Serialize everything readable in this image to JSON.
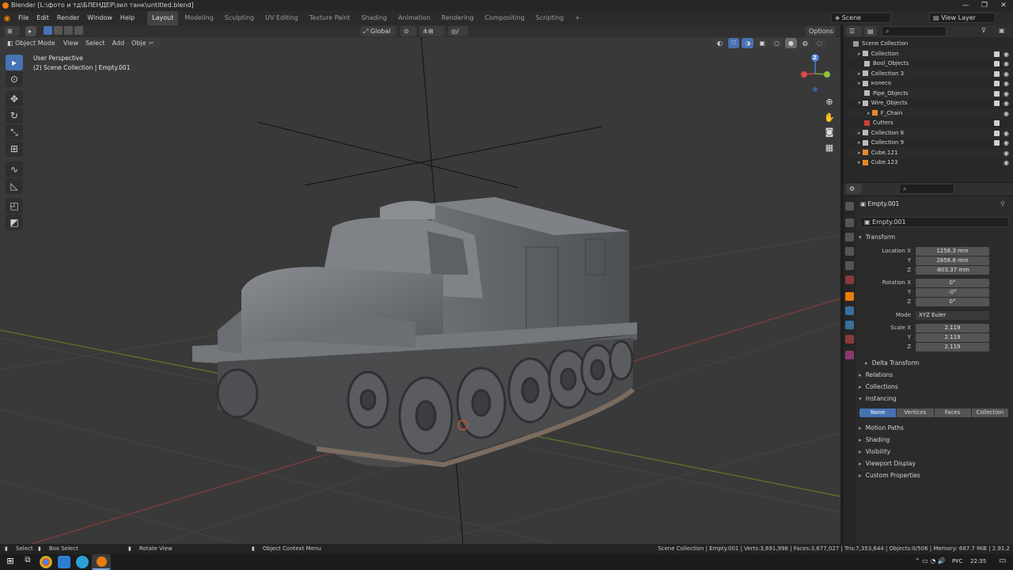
{
  "window": {
    "title": "Blender [L:\\фото и тд\\БЛЕНДЕР\\зил танк\\untitled.blend]",
    "controls": [
      "—",
      "❐",
      "✕"
    ]
  },
  "menubar": {
    "menus": [
      "File",
      "Edit",
      "Render",
      "Window",
      "Help"
    ],
    "workspaces": [
      "Layout",
      "Modeling",
      "Sculpting",
      "UV Editing",
      "Texture Paint",
      "Shading",
      "Animation",
      "Rendering",
      "Compositing",
      "Scripting"
    ],
    "active_workspace": "Layout",
    "add_tab": "+",
    "scene": "Scene",
    "view_layer": "View Layer"
  },
  "viewport_header": {
    "mode": "Object Mode",
    "menus": [
      "View",
      "Select",
      "Add",
      "Object"
    ],
    "orientation": "Global",
    "options": "Options"
  },
  "viewport": {
    "perspective_label": "User Perspective",
    "context_label": "(2) Scene Collection | Empty.001",
    "gizmo_axis_z": "Z"
  },
  "outliner": {
    "root": "Scene Collection",
    "search_placeholder": "",
    "items": [
      {
        "name": "Collection",
        "checked": true,
        "visible": true
      },
      {
        "name": "Bool_Objects",
        "checked": true,
        "visible": true
      },
      {
        "name": "Collection 3",
        "checked": true,
        "visible": true
      },
      {
        "name": "колесо",
        "checked": true,
        "visible": true
      },
      {
        "name": "Pipe_Objects",
        "checked": true,
        "visible": true
      },
      {
        "name": "Wire_Objects",
        "checked": true,
        "visible": true
      },
      {
        "name": "F_Chain",
        "checked": false,
        "visible": true
      },
      {
        "name": "Cutters",
        "checked": true,
        "visible": false
      },
      {
        "name": "Collection 8",
        "checked": true,
        "visible": true
      },
      {
        "name": "Collection 9",
        "checked": true,
        "visible": true
      },
      {
        "name": "Cube.121",
        "checked": false,
        "visible": true
      },
      {
        "name": "Cube.123",
        "checked": false,
        "visible": true
      }
    ]
  },
  "properties": {
    "object_name": "Empty.001",
    "object_field": "Empty.001",
    "transform": {
      "header": "Transform",
      "location_label": "Location X",
      "location": [
        "1258.3 mm",
        "2858.8 mm",
        "-803.37 mm"
      ],
      "rotation_label": "Rotation X",
      "rotation": [
        "0°",
        "-0°",
        "0°"
      ],
      "mode_label": "Mode",
      "mode": "XYZ Euler",
      "scale_label": "Scale X",
      "scale": [
        "2.119",
        "2.119",
        "2.119"
      ],
      "y_label": "Y",
      "z_label": "Z",
      "delta": "Delta Transform"
    },
    "sections": [
      "Relations",
      "Collections",
      "Instancing"
    ],
    "instancing_options": [
      "None",
      "Vertices",
      "Faces",
      "Collection"
    ],
    "instancing_active": "None",
    "more_sections": [
      "Motion Paths",
      "Shading",
      "Visibility",
      "Viewport Display",
      "Custom Properties"
    ]
  },
  "statusbar": {
    "select": "Select",
    "box_select": "Box Select",
    "rotate_view": "Rotate View",
    "context_menu": "Object Context Menu",
    "stats": "Scene Collection | Empty.001 | Verts:3,691,996 | Faces:3,677,027 | Tris:7,353,644 | Objects:0/506 | Memory: 687.7 MiB | 2.91.2"
  },
  "taskbar": {
    "lang": "РУС",
    "time": "22:35"
  },
  "colors": {
    "accent": "#4772b3",
    "active_object": "#e87d0d",
    "viewport_bg": "#393939"
  }
}
